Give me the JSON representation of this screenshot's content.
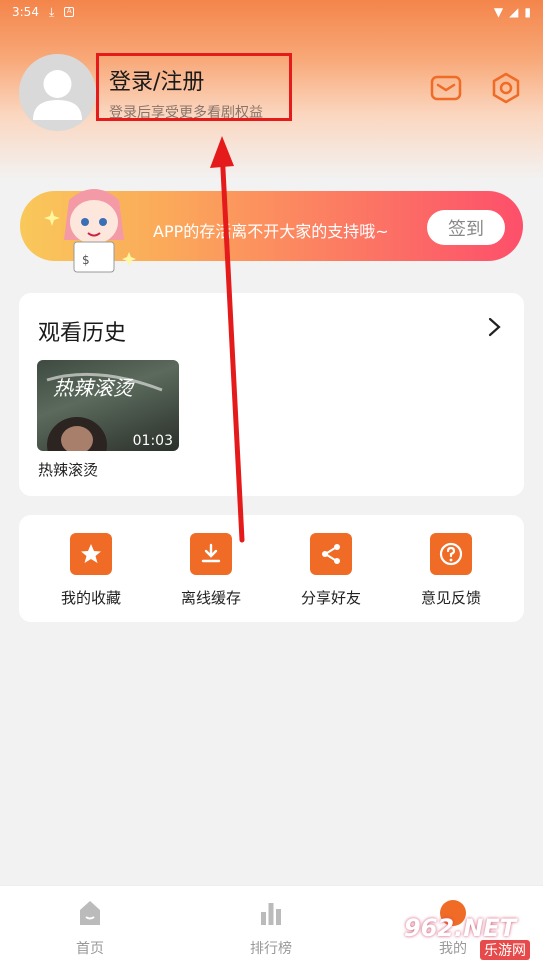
{
  "status_bar": {
    "time": "3:54"
  },
  "profile": {
    "title": "登录/注册",
    "subtitle": "登录后享受更多看剧权益"
  },
  "header_icons": [
    "message-icon",
    "settings-icon"
  ],
  "banner": {
    "text": "APP的存活离不开大家的支持哦~",
    "button_label": "签到"
  },
  "history": {
    "title": "观看历史",
    "items": [
      {
        "title": "热辣滚烫",
        "duration": "01:03",
        "thumb_overlay": "热辣滚烫"
      }
    ]
  },
  "features": [
    {
      "label": "我的收藏",
      "icon": "star-icon"
    },
    {
      "label": "离线缓存",
      "icon": "download-icon"
    },
    {
      "label": "分享好友",
      "icon": "share-icon"
    },
    {
      "label": "意见反馈",
      "icon": "feedback-icon"
    }
  ],
  "bottom_nav": [
    {
      "label": "首页",
      "icon": "home-icon"
    },
    {
      "label": "排行榜",
      "icon": "ranking-icon"
    },
    {
      "label": "我的",
      "icon": "profile-icon"
    }
  ],
  "watermark": {
    "brand": "962.NET",
    "site": "乐游网"
  },
  "colors": {
    "accent": "#f06b25",
    "highlight": "#e51b1b"
  }
}
